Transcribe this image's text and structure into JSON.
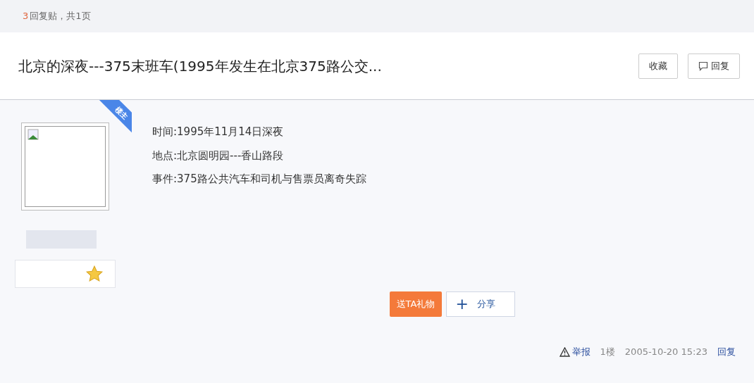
{
  "thread_info": {
    "reply_count": "3",
    "text": "回复贴，共1页"
  },
  "title": "北京的深夜---375末班车(1995年发生在北京375路公交...",
  "header_buttons": [
    {
      "kind": "plain",
      "label": "收藏"
    },
    {
      "kind": "reply",
      "label": "回复"
    }
  ],
  "post": {
    "badge": "楼主",
    "lines": [
      "时间:1995年11月14日深夜",
      "地点:北京圆明园---香山路段",
      "事件:375路公共汽车和司机与售票员离奇失踪"
    ],
    "gift_button": "送TA礼物",
    "share_button": {
      "icon": "+",
      "label": "分享"
    },
    "footer": {
      "report": "举报",
      "floor": "1楼",
      "time": "2005-10-20 15:23",
      "reply": "回复"
    }
  }
}
